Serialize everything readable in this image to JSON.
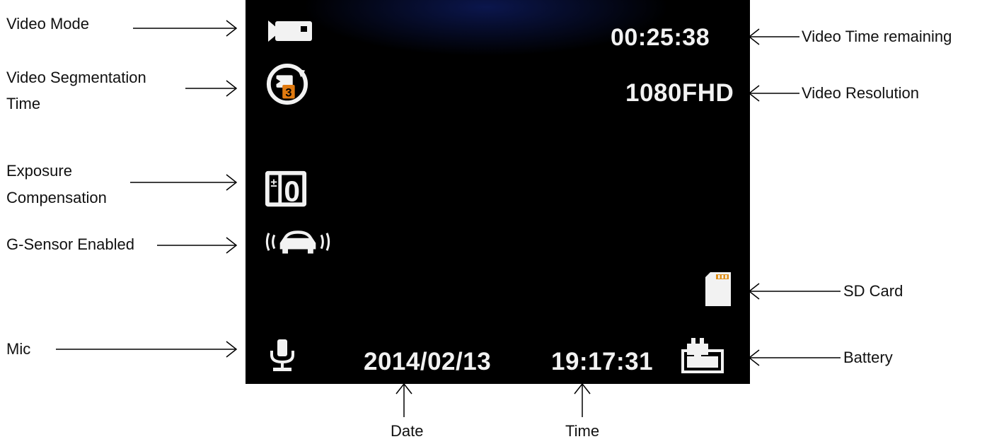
{
  "labels": {
    "video_mode": "Video Mode",
    "segmentation_line1": "Video Segmentation",
    "segmentation_line2": "Time",
    "exposure_line1": "Exposure",
    "exposure_line2": "Compensation",
    "gsensor": "G-Sensor Enabled",
    "mic": "Mic",
    "time_remaining": "Video Time remaining",
    "resolution": "Video Resolution",
    "sd_card": "SD Card",
    "battery": "Battery",
    "date": "Date",
    "time": "Time"
  },
  "screen": {
    "time_remaining": "00:25:38",
    "resolution": "1080FHD",
    "exposure_value": "0",
    "segmentation_value": "3",
    "date": "2014/02/13",
    "clock": "19:17:31"
  },
  "icons": {
    "video_mode": "video-camera-icon",
    "segmentation": "loop-recording-icon",
    "exposure": "exposure-compensation-icon",
    "gsensor": "car-shock-icon",
    "mic": "microphone-icon",
    "sd_card": "sd-card-icon",
    "battery": "battery-plug-icon"
  },
  "colors": {
    "screen_bg": "#000000",
    "osd_text": "#f2f2f2",
    "segmentation_accent": "#e07a10",
    "sd_card_stripe": "#e0901a"
  }
}
